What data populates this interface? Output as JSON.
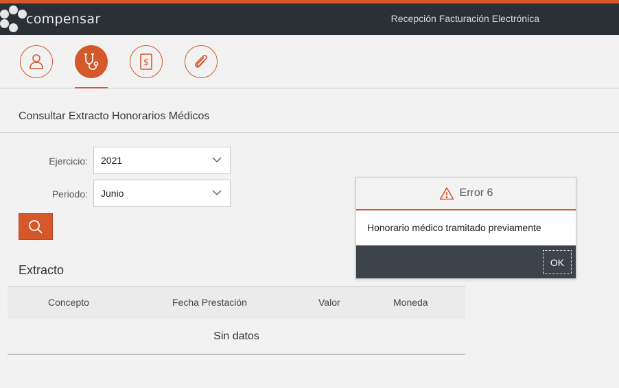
{
  "header": {
    "logo_text": "compensar",
    "title": "Recepción Facturación Electrónica",
    "accent_color": "#d4582a"
  },
  "steps": [
    {
      "icon": "user-icon",
      "active": false
    },
    {
      "icon": "stethoscope-icon",
      "active": true
    },
    {
      "icon": "invoice-dollar-icon",
      "active": false
    },
    {
      "icon": "paperclip-icon",
      "active": false
    }
  ],
  "section": {
    "title": "Consultar Extracto Honorarios Médicos"
  },
  "form": {
    "ejercicio_label": "Ejercicio:",
    "ejercicio_value": "2021",
    "periodo_label": "Periodo:",
    "periodo_value": "Junio",
    "search_icon": "search-icon"
  },
  "extracto": {
    "title": "Extracto",
    "columns": [
      "Concepto",
      "Fecha Prestación",
      "Valor",
      "Moneda"
    ],
    "empty_text": "Sin datos"
  },
  "dialog": {
    "title": "Error 6",
    "message": "Honorario médico tramitado previamente",
    "ok_label": "OK",
    "icon": "warning-icon"
  }
}
